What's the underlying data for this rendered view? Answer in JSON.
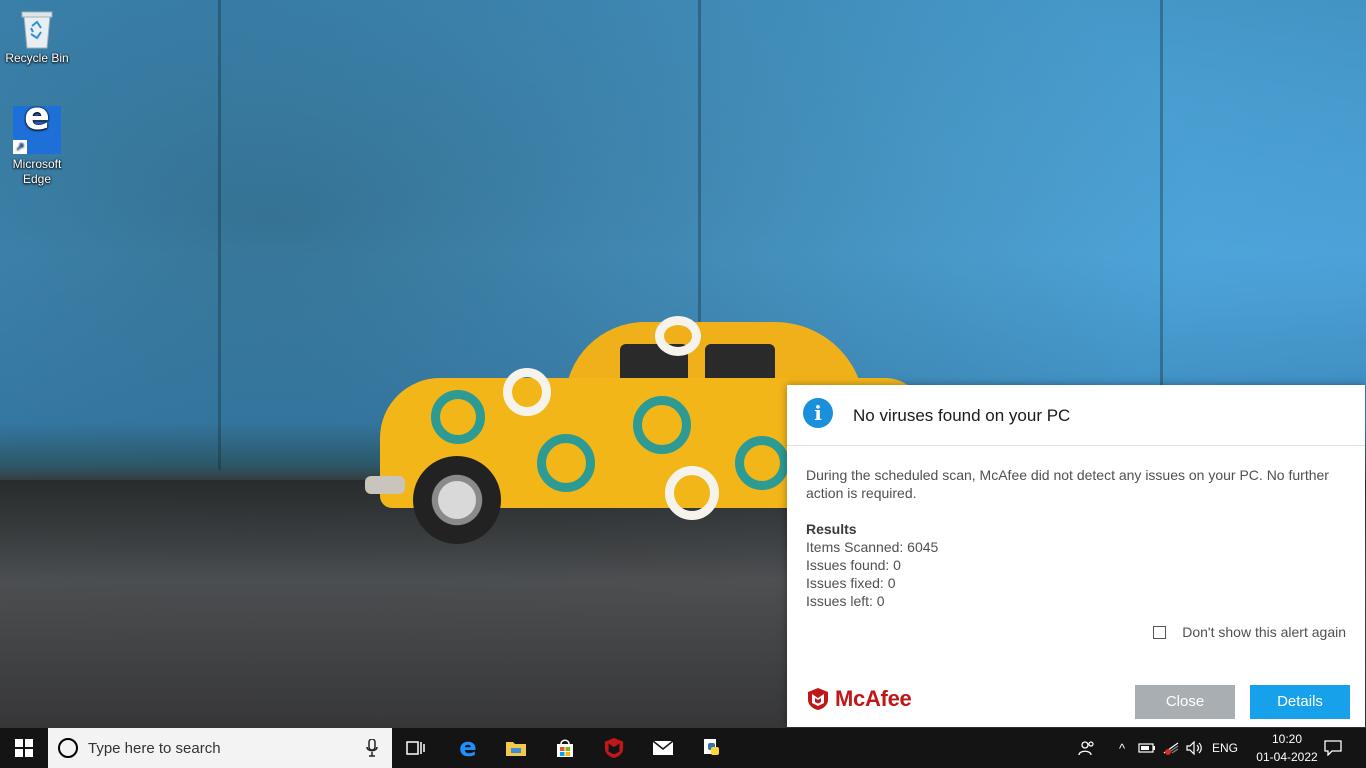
{
  "desktop": {
    "icons": [
      {
        "label": "Recycle Bin"
      },
      {
        "label": "Microsoft Edge"
      }
    ]
  },
  "notification": {
    "title": "No viruses found on your PC",
    "message": "During the scheduled scan, McAfee did not detect any issues on your PC. No further action is required.",
    "results_heading": "Results",
    "items_scanned": "Items Scanned: 6045",
    "issues_found": "Issues found: 0",
    "issues_fixed": "Issues fixed: 0",
    "issues_left": "Issues left: 0",
    "dont_show_label": "Don't show this alert again",
    "dont_show_checked": false,
    "brand": "McAfee",
    "close_label": "Close",
    "details_label": "Details",
    "colors": {
      "brand": "#c01818",
      "primary_button": "#16a1ea",
      "secondary_button": "#a9aeb2",
      "info": "#1a8fdc"
    }
  },
  "taskbar": {
    "search_placeholder": "Type here to search",
    "pinned": [
      "task-view-icon",
      "edge-icon",
      "file-explorer-icon",
      "store-icon",
      "mcafee-icon",
      "mail-icon",
      "python-icon"
    ],
    "tray": {
      "language": "ENG",
      "time": "10:20",
      "date": "01-04-2022"
    }
  }
}
